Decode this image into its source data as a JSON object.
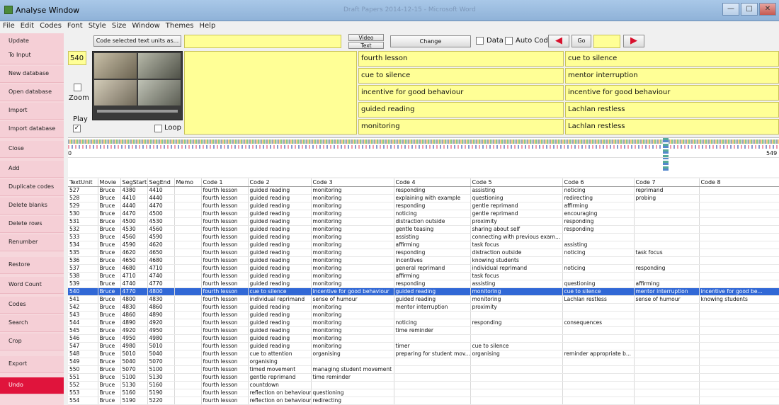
{
  "window": {
    "title": "Analyse Window",
    "doc_title": "Draft Papers 2014-12-15 - Microsoft Word"
  },
  "menu": [
    "File",
    "Edit",
    "Codes",
    "Font",
    "Style",
    "Size",
    "Window",
    "Themes",
    "Help"
  ],
  "sidebar": [
    {
      "label": "Update",
      "active": false
    },
    {
      "label": "To Input",
      "active": false
    },
    {
      "label": "New database",
      "active": false
    },
    {
      "label": "Open database",
      "active": false
    },
    {
      "label": "Import",
      "active": false
    },
    {
      "label": "Import database",
      "active": false
    },
    {
      "label": "Close",
      "active": false
    },
    {
      "label": "Add",
      "active": false
    },
    {
      "label": "Duplicate codes",
      "active": false
    },
    {
      "label": "Delete blanks",
      "active": false
    },
    {
      "label": "Delete rows",
      "active": false
    },
    {
      "label": "Renumber",
      "active": false
    },
    {
      "label": "Restore",
      "active": false
    },
    {
      "label": "Word Count",
      "active": false
    },
    {
      "label": "Codes",
      "active": false
    },
    {
      "label": "Search",
      "active": false
    },
    {
      "label": "Crop",
      "active": false
    },
    {
      "label": "Export",
      "active": false
    },
    {
      "label": "Undo",
      "active": true
    }
  ],
  "toolbar": {
    "code_selected": "Code selected text units as...",
    "video": "Video",
    "text": "Text",
    "change": "Change",
    "data": "Data",
    "auto_codes": "Auto Codes",
    "go": "Go"
  },
  "player": {
    "unit": "540",
    "zoom": "Zoom",
    "play": "Play",
    "play_checked": "✓",
    "loop": "Loop"
  },
  "codes_middle": [
    "fourth lesson",
    "cue to silence",
    "incentive for good behaviour",
    "guided reading",
    "monitoring"
  ],
  "codes_right": [
    "cue to silence",
    "mentor interruption",
    "incentive for good behaviour",
    "Lachlan restless",
    "Lachlan restless"
  ],
  "timeline": {
    "start": "0",
    "end": "549"
  },
  "table": {
    "columns": [
      "TextUnit",
      "Movie",
      "SegStart",
      "SegEnd",
      "Memo",
      "Code 1",
      "Code 2",
      "Code 3",
      "Code 4",
      "Code 5",
      "Code 6",
      "Code 7",
      "Code 8"
    ],
    "selected_row": 13,
    "rows": [
      [
        "527",
        "Bruce",
        "4380",
        "4410",
        "",
        "fourth lesson",
        "guided reading",
        "monitoring",
        "responding",
        "assisting",
        "noticing",
        "reprimand",
        ""
      ],
      [
        "528",
        "Bruce",
        "4410",
        "4440",
        "",
        "fourth lesson",
        "guided reading",
        "monitoring",
        "explaining with example",
        "questioning",
        "redirecting",
        "probing",
        ""
      ],
      [
        "529",
        "Bruce",
        "4440",
        "4470",
        "",
        "fourth lesson",
        "guided reading",
        "monitoring",
        "responding",
        "gentle reprimand",
        "affirming",
        "",
        ""
      ],
      [
        "530",
        "Bruce",
        "4470",
        "4500",
        "",
        "fourth lesson",
        "guided reading",
        "monitoring",
        "noticing",
        "gentle reprimand",
        "encouraging",
        "",
        ""
      ],
      [
        "531",
        "Bruce",
        "4500",
        "4530",
        "",
        "fourth lesson",
        "guided reading",
        "monitoring",
        "distraction outside",
        "proximity",
        "responding",
        "",
        ""
      ],
      [
        "532",
        "Bruce",
        "4530",
        "4560",
        "",
        "fourth lesson",
        "guided reading",
        "monitoring",
        "gentle teasing",
        "sharing about self",
        "responding",
        "",
        ""
      ],
      [
        "533",
        "Bruce",
        "4560",
        "4590",
        "",
        "fourth lesson",
        "guided reading",
        "monitoring",
        "assisting",
        "connecting with previous exam...",
        "",
        "",
        ""
      ],
      [
        "534",
        "Bruce",
        "4590",
        "4620",
        "",
        "fourth lesson",
        "guided reading",
        "monitoring",
        "affirming",
        "task focus",
        "assisting",
        "",
        ""
      ],
      [
        "535",
        "Bruce",
        "4620",
        "4650",
        "",
        "fourth lesson",
        "guided reading",
        "monitoring",
        "responding",
        "distraction outside",
        "noticing",
        "task focus",
        ""
      ],
      [
        "536",
        "Bruce",
        "4650",
        "4680",
        "",
        "fourth lesson",
        "guided reading",
        "monitoring",
        "incentives",
        "knowing students",
        "",
        "",
        ""
      ],
      [
        "537",
        "Bruce",
        "4680",
        "4710",
        "",
        "fourth lesson",
        "guided reading",
        "monitoring",
        "general reprimand",
        "individual reprimand",
        "noticing",
        "responding",
        ""
      ],
      [
        "538",
        "Bruce",
        "4710",
        "4740",
        "",
        "fourth lesson",
        "guided reading",
        "monitoring",
        "affirming",
        "task focus",
        "",
        "",
        ""
      ],
      [
        "539",
        "Bruce",
        "4740",
        "4770",
        "",
        "fourth lesson",
        "guided reading",
        "monitoring",
        "responding",
        "assisting",
        "questioning",
        "affirming",
        ""
      ],
      [
        "540",
        "Bruce",
        "4770",
        "4800",
        "",
        "fourth lesson",
        "cue to silence",
        "incentive for good behaviour",
        "guided reading",
        "monitoring",
        "cue to silence",
        "mentor interruption",
        "incentive for good be..."
      ],
      [
        "541",
        "Bruce",
        "4800",
        "4830",
        "",
        "fourth lesson",
        "individual reprimand",
        "sense of humour",
        "guided reading",
        "monitoring",
        "Lachlan restless",
        "sense of humour",
        "knowing students"
      ],
      [
        "542",
        "Bruce",
        "4830",
        "4860",
        "",
        "fourth lesson",
        "guided reading",
        "monitoring",
        "mentor interruption",
        "proximity",
        "",
        "",
        ""
      ],
      [
        "543",
        "Bruce",
        "4860",
        "4890",
        "",
        "fourth lesson",
        "guided reading",
        "monitoring",
        "",
        "",
        "",
        "",
        ""
      ],
      [
        "544",
        "Bruce",
        "4890",
        "4920",
        "",
        "fourth lesson",
        "guided reading",
        "monitoring",
        "noticing",
        "responding",
        "consequences",
        "",
        ""
      ],
      [
        "545",
        "Bruce",
        "4920",
        "4950",
        "",
        "fourth lesson",
        "guided reading",
        "monitoring",
        "time reminder",
        "",
        "",
        "",
        ""
      ],
      [
        "546",
        "Bruce",
        "4950",
        "4980",
        "",
        "fourth lesson",
        "guided reading",
        "monitoring",
        "",
        "",
        "",
        "",
        ""
      ],
      [
        "547",
        "Bruce",
        "4980",
        "5010",
        "",
        "fourth lesson",
        "guided reading",
        "monitoring",
        "timer",
        "cue to silence",
        "",
        "",
        ""
      ],
      [
        "548",
        "Bruce",
        "5010",
        "5040",
        "",
        "fourth lesson",
        "cue to attention",
        "organising",
        "preparing for student mov...",
        "organising",
        "reminder appropriate b...",
        "",
        ""
      ],
      [
        "549",
        "Bruce",
        "5040",
        "5070",
        "",
        "fourth lesson",
        "organising",
        "",
        "",
        "",
        "",
        "",
        ""
      ],
      [
        "550",
        "Bruce",
        "5070",
        "5100",
        "",
        "fourth lesson",
        "timed movement",
        "managing student movement",
        "",
        "",
        "",
        "",
        ""
      ],
      [
        "551",
        "Bruce",
        "5100",
        "5130",
        "",
        "fourth lesson",
        "gentle reprimand",
        "time reminder",
        "",
        "",
        "",
        "",
        ""
      ],
      [
        "552",
        "Bruce",
        "5130",
        "5160",
        "",
        "fourth lesson",
        "countdown",
        "",
        "",
        "",
        "",
        "",
        ""
      ],
      [
        "553",
        "Bruce",
        "5160",
        "5190",
        "",
        "fourth lesson",
        "reflection on behaviour",
        "questioning",
        "",
        "",
        "",
        "",
        ""
      ],
      [
        "554",
        "Bruce",
        "5190",
        "5220",
        "",
        "fourth lesson",
        "reflection on behaviour",
        "redirecting",
        "",
        "",
        "",
        "",
        ""
      ],
      [
        "555",
        "Bruce",
        "5220",
        "5250",
        "",
        "fourth lesson",
        "redirecting",
        "reflection on behaviour",
        "group feedback",
        "consequences",
        "",
        "",
        ""
      ],
      [
        "556",
        "Bruce",
        "5250",
        "5280",
        "",
        "fourth lesson",
        "reflection on behaviour",
        "redirecting",
        "explaining",
        "",
        "",
        "",
        ""
      ]
    ]
  }
}
